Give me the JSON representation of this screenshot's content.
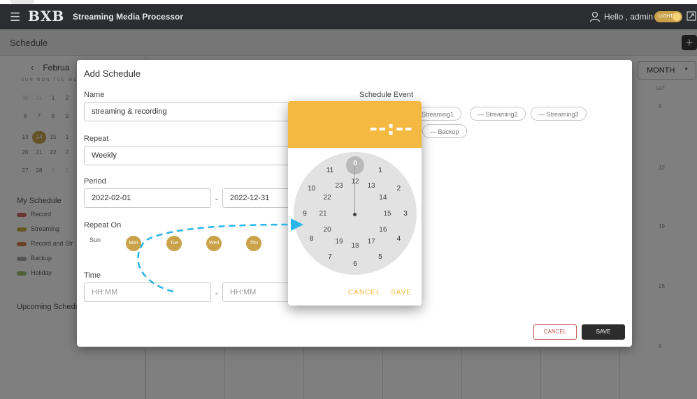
{
  "topbar": {
    "logo": "BXB",
    "app_title": "Streaming Media Processor",
    "greeting": "Hello , admin",
    "theme_label": "LIGHT"
  },
  "page": {
    "title": "Schedule"
  },
  "mini_calendar": {
    "month": "Februa",
    "weekdays": "SUN MON TUE WE",
    "rows": [
      [
        {
          "d": "30",
          "dim": true
        },
        {
          "d": "31",
          "dim": true
        },
        {
          "d": "1"
        },
        {
          "d": "2"
        }
      ],
      [
        {
          "d": "6"
        },
        {
          "d": "7"
        },
        {
          "d": "8"
        },
        {
          "d": "9"
        }
      ],
      [
        {
          "d": "13"
        },
        {
          "d": "14",
          "sel": true
        },
        {
          "d": "15"
        },
        {
          "d": "1"
        }
      ],
      [
        {
          "d": "20"
        },
        {
          "d": "21"
        },
        {
          "d": "22"
        },
        {
          "d": "2"
        }
      ],
      [
        {
          "d": "27"
        },
        {
          "d": "28"
        },
        {
          "d": "1",
          "dim": true
        },
        {
          "d": "2",
          "dim": true
        }
      ]
    ]
  },
  "my_schedule": {
    "title": "My Schedule",
    "items": [
      {
        "label": "Record",
        "color": "#d46a6a"
      },
      {
        "label": "Streaming",
        "color": "#c9b14a"
      },
      {
        "label": "Record and Str",
        "color": "#d9824a"
      },
      {
        "label": "Backup",
        "color": "#aaaaaa"
      },
      {
        "label": "Holiday",
        "color": "#9ac26a"
      }
    ]
  },
  "upcoming": {
    "title": "Upcoming Schedul"
  },
  "calendar": {
    "view": "MONTH",
    "sat_label": "SAT",
    "dates": [
      "5",
      "12",
      "19",
      "26",
      "5"
    ]
  },
  "dialog": {
    "title": "Add Schedule",
    "name_label": "Name",
    "name_value": "streaming & recording",
    "repeat_label": "Repeat",
    "repeat_value": "Weekly",
    "period_label": "Period",
    "period_start": "2022-02-01",
    "period_end": "2022-12-31",
    "repeat_on_label": "Repeat On",
    "days": {
      "sun": "Sun",
      "mon": "Mon",
      "tue": "Tue",
      "wed": "Wed",
      "thu": "Thu"
    },
    "time_label": "Time",
    "time_start_placeholder": "HH:MM",
    "time_end_placeholder": "HH:MM",
    "separator": "-",
    "event_label": "Schedule Event",
    "events": [
      "Streaming1",
      "Streaming2",
      "Streaming3",
      "Backup"
    ],
    "cancel": "CANCEL",
    "save": "SAVE"
  },
  "time_picker": {
    "display": "--:--",
    "selected": "0",
    "outer_hours": [
      "0",
      "1",
      "2",
      "3",
      "4",
      "5",
      "6",
      "7",
      "8",
      "9",
      "10",
      "11"
    ],
    "inner_hours": [
      "12",
      "13",
      "14",
      "15",
      "16",
      "17",
      "18",
      "19",
      "20",
      "21",
      "22",
      "23"
    ],
    "cancel": "CANCEL",
    "save": "SAVE"
  },
  "colors": {
    "accent": "#f3b941",
    "day_selected": "#c9a24a",
    "annotation_arrow": "#29b6e8"
  }
}
